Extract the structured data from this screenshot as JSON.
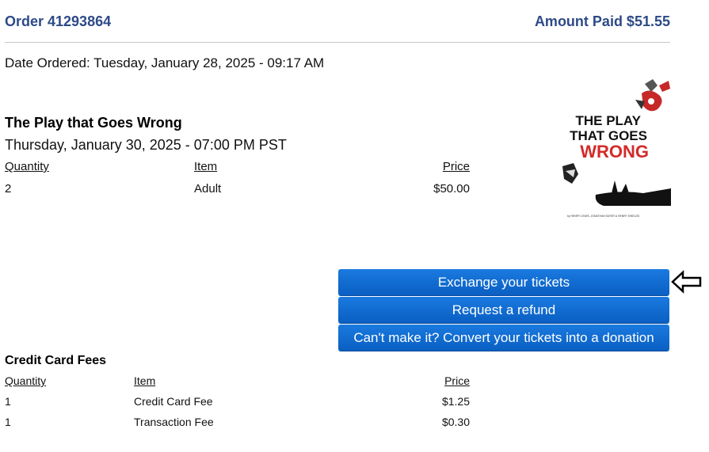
{
  "order": {
    "title": "Order 41293864",
    "amount_paid": "Amount Paid $51.55",
    "date_ordered": "Date Ordered: Tuesday, January 28, 2025 - 09:17 AM"
  },
  "event": {
    "name": "The Play that Goes Wrong",
    "datetime": "Thursday, January 30, 2025 - 07:00 PM PST",
    "headers": {
      "quantity": "Quantity",
      "item": "Item",
      "price": "Price"
    },
    "rows": [
      {
        "quantity": "2",
        "item": "Adult",
        "price": "$50.00"
      }
    ],
    "poster": {
      "line1": "THE PLAY",
      "line2": "THAT GOES",
      "line3": "WRONG",
      "credits": "by HENRY LEWIS, JONATHAN SAYER & HENRY SHIELDS"
    }
  },
  "actions": {
    "exchange": "Exchange your tickets",
    "refund": "Request a refund",
    "donate": "Can't make it? Convert your tickets into a donation"
  },
  "fees": {
    "title": "Credit Card Fees",
    "headers": {
      "quantity": "Quantity",
      "item": "Item",
      "price": "Price"
    },
    "rows": [
      {
        "quantity": "1",
        "item": "Credit Card Fee",
        "price": "$1.25"
      },
      {
        "quantity": "1",
        "item": "Transaction Fee",
        "price": "$0.30"
      }
    ]
  },
  "colors": {
    "heading": "#2d4a87",
    "button": "#0a67cc",
    "poster_red": "#d42a2a"
  },
  "icons": {
    "pointer": "left-arrow-icon"
  }
}
